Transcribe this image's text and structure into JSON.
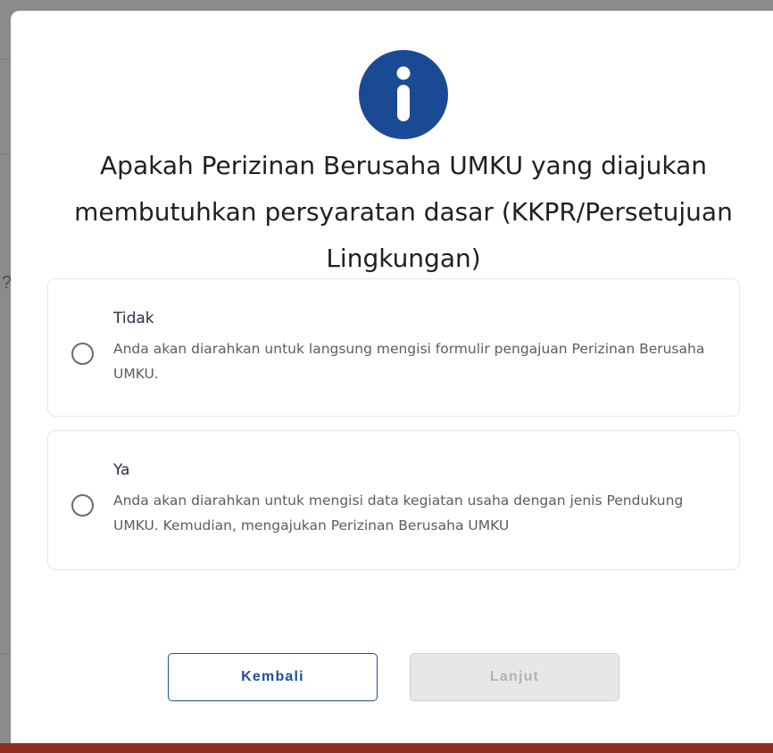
{
  "dialog": {
    "title": "Apakah Perizinan Berusaha UMKU yang diajukan membutuhkan persyaratan dasar (KKPR/Persetujuan Lingkungan)",
    "icon": "info-icon",
    "icon_color": "#1b4a95",
    "options": [
      {
        "label": "Tidak",
        "description": "Anda akan diarahkan untuk langsung mengisi formulir pengajuan Perizinan Berusaha UMKU.",
        "selected": false
      },
      {
        "label": "Ya",
        "description": "Anda akan diarahkan untuk mengisi data kegiatan usaha dengan jenis Pendukung UMKU. Kemudian, mengajukan Perizinan Berusaha UMKU",
        "selected": false
      }
    ],
    "buttons": {
      "back_label": "Kembali",
      "next_label": "Lanjut",
      "next_disabled": true
    }
  },
  "background": {
    "partial_text": "?",
    "footer_color": "#8e2d22"
  }
}
